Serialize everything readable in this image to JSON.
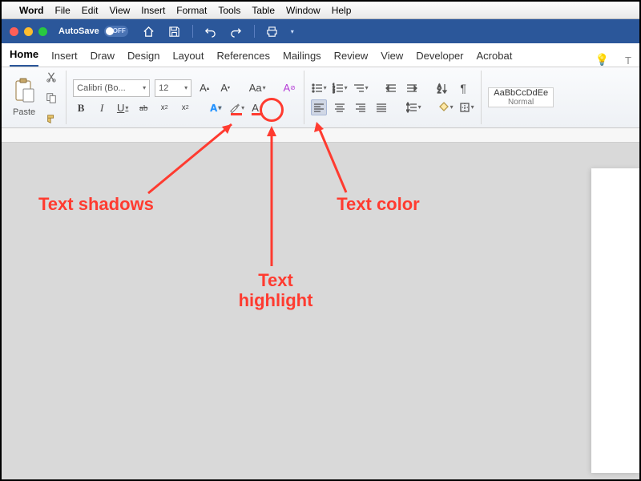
{
  "menubar": {
    "app": "Word",
    "items": [
      "File",
      "Edit",
      "View",
      "Insert",
      "Format",
      "Tools",
      "Table",
      "Window",
      "Help"
    ]
  },
  "titlebar": {
    "autosave_label": "AutoSave",
    "autosave_state": "OFF"
  },
  "tabs": {
    "items": [
      "Home",
      "Insert",
      "Draw",
      "Design",
      "Layout",
      "References",
      "Mailings",
      "Review",
      "View",
      "Developer",
      "Acrobat"
    ],
    "active": "Home",
    "trail": "T"
  },
  "ribbon": {
    "clipboard": {
      "paste": "Paste"
    },
    "font": {
      "name": "Calibri (Bo...",
      "size": "12",
      "bold": "B",
      "italic": "I",
      "underline": "U",
      "strike": "ab",
      "sub": "x",
      "sup": "x",
      "grow": "A",
      "shrink": "A",
      "case": "Aa",
      "clear": "A",
      "effects": "A",
      "highlight": "ab",
      "color": "A"
    },
    "styles": {
      "sample": "AaBbCcDdEe",
      "name": "Normal"
    }
  },
  "annotations": {
    "shadows": "Text shadows",
    "highlight": "Text\nhighlight",
    "color": "Text color"
  }
}
